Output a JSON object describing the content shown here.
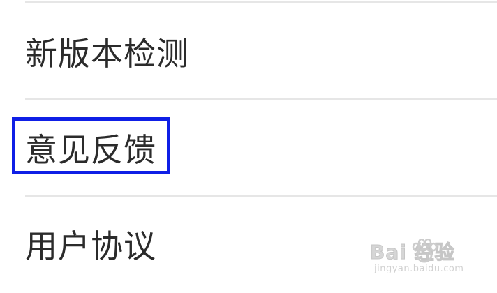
{
  "menu": {
    "items": [
      {
        "label": "新版本检测"
      },
      {
        "label": "意见反馈",
        "highlighted": true
      },
      {
        "label": "用户协议"
      }
    ]
  },
  "watermark": {
    "brand": "Bai 经验",
    "url": "jingyan.baidu.com"
  },
  "colors": {
    "background": "#ffffff",
    "text": "#2b2b2b",
    "divider": "#e6e6e6",
    "highlight": "#0f1fe6"
  }
}
